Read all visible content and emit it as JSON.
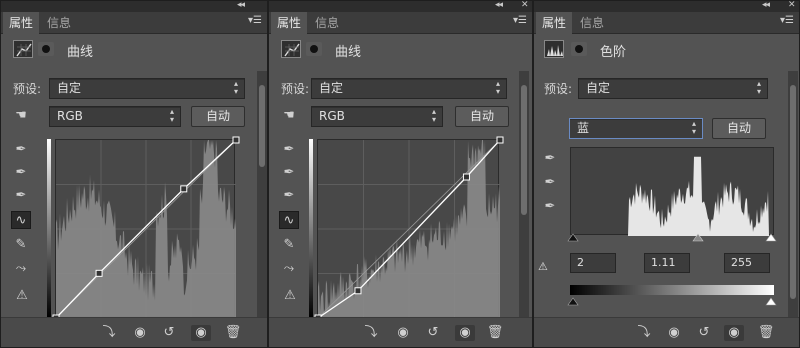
{
  "panels": [
    {
      "tabs": [
        "属性",
        "信息"
      ],
      "header_icon": "curves-adjustment-icon",
      "title": "曲线",
      "preset_label": "预设:",
      "preset_value": "自定",
      "channel_value": "RGB",
      "auto_label": "自动",
      "curve_points": [
        [
          0,
          0
        ],
        [
          61,
          64
        ],
        [
          181,
          185
        ],
        [
          255,
          255
        ]
      ]
    },
    {
      "tabs": [
        "属性",
        "信息"
      ],
      "header_icon": "curves-adjustment-icon",
      "title": "曲线",
      "preset_label": "预设:",
      "preset_value": "自定",
      "channel_value": "RGB",
      "auto_label": "自动",
      "curve_points": [
        [
          0,
          0
        ],
        [
          56,
          39
        ],
        [
          208,
          202
        ],
        [
          255,
          255
        ]
      ]
    },
    {
      "tabs": [
        "属性",
        "信息"
      ],
      "header_icon": "levels-adjustment-icon",
      "title": "色阶",
      "preset_label": "预设:",
      "preset_value": "自定",
      "channel_value": "蓝",
      "auto_label": "自动",
      "input_black": "2",
      "input_gamma": "1.11",
      "input_white": "255"
    }
  ],
  "colors": {
    "panel": "#535353",
    "tab_bar": "#3c3c3c",
    "histogram": "#8a8a8a",
    "levels_histogram": "#e6e6e6"
  }
}
